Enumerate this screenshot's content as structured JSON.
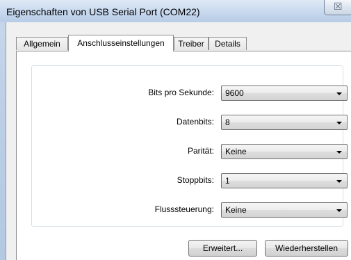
{
  "window": {
    "title": "Eigenschaften von USB Serial Port (COM22)",
    "close_glyph": "☒"
  },
  "tabs": [
    {
      "label": "Allgemein",
      "active": false
    },
    {
      "label": "Anschlusseinstellungen",
      "active": true
    },
    {
      "label": "Treiber",
      "active": false
    },
    {
      "label": "Details",
      "active": false
    }
  ],
  "settings": [
    {
      "label": "Bits pro Sekunde:",
      "value": "9600"
    },
    {
      "label": "Datenbits:",
      "value": "8"
    },
    {
      "label": "Parität:",
      "value": "Keine"
    },
    {
      "label": "Stoppbits:",
      "value": "1"
    },
    {
      "label": "Flusssteuerung:",
      "value": "Keine"
    }
  ],
  "buttons": {
    "advanced": "Erweitert...",
    "restore": "Wiederherstellen"
  }
}
